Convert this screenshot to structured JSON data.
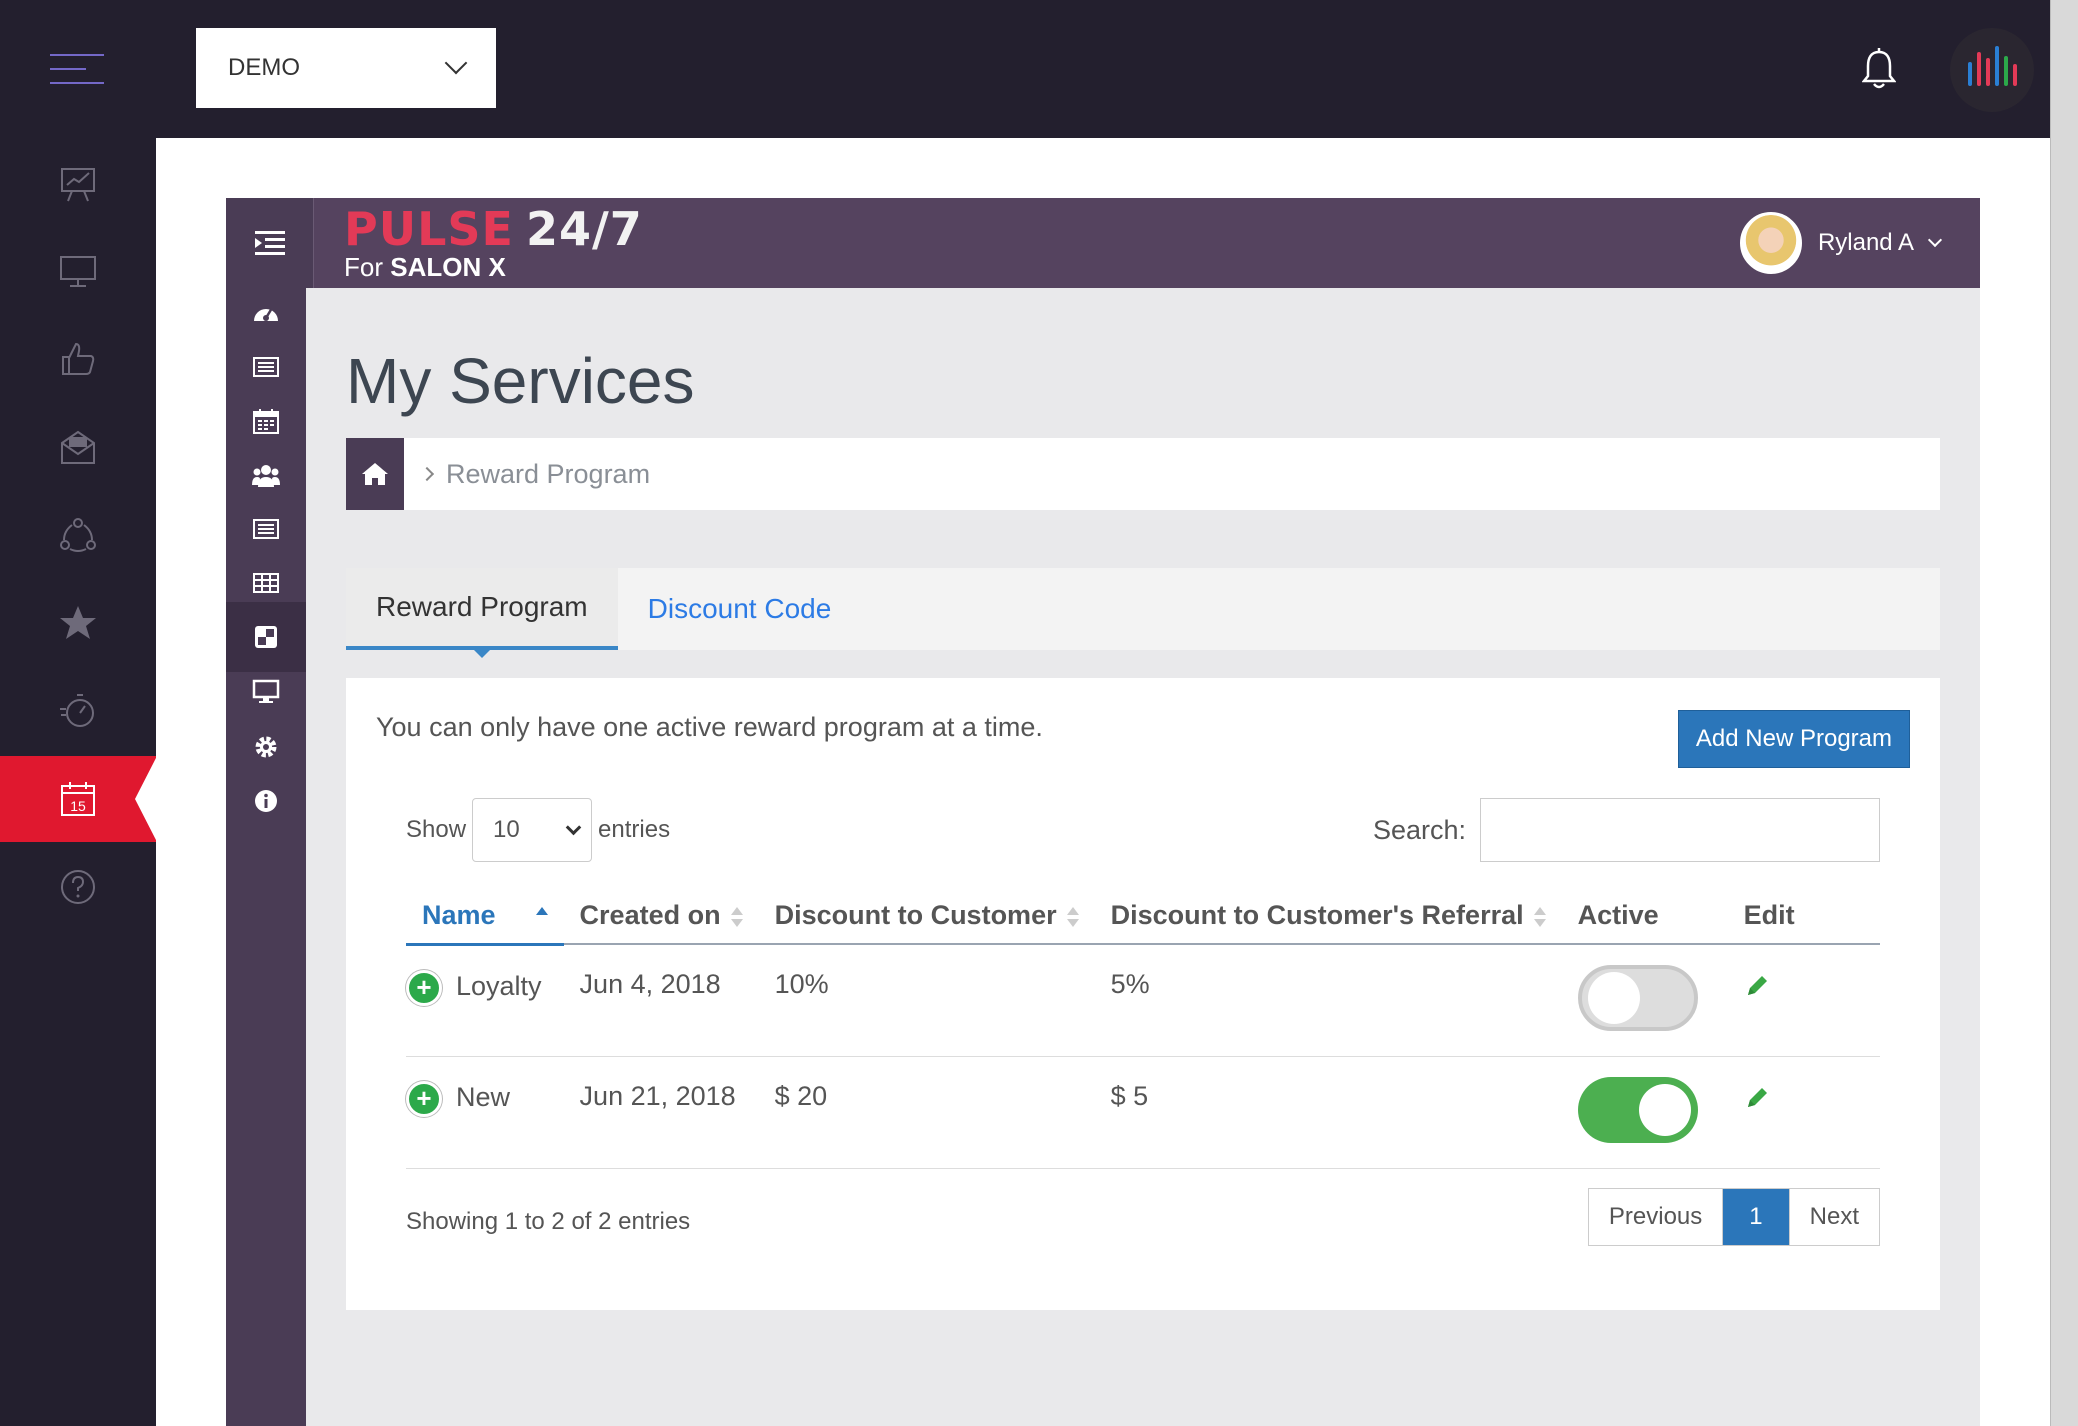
{
  "topbar": {
    "org_selector_value": "DEMO",
    "icons": [
      "hamburger-icon",
      "bell-icon",
      "app-logo-icon"
    ]
  },
  "left_rail": {
    "items": [
      {
        "icon": "analytics-board-icon"
      },
      {
        "icon": "monitor-icon"
      },
      {
        "icon": "thumbs-up-icon"
      },
      {
        "icon": "mail-open-icon"
      },
      {
        "icon": "share-network-icon"
      },
      {
        "icon": "star-icon"
      },
      {
        "icon": "stopwatch-icon"
      },
      {
        "icon": "calendar-icon",
        "label": "15",
        "active": true
      },
      {
        "icon": "help-circle-icon"
      }
    ],
    "accent_color": "#e0182f"
  },
  "pulse": {
    "brand_part1": "PULSE",
    "brand_part2": "24/7",
    "brand_for": "For",
    "brand_salon": "SALON X",
    "user_name": "Ryland A",
    "sidebar_icons": [
      "dashboard-gauge-icon",
      "list-icon",
      "calendar-icon",
      "users-icon",
      "list-alt-icon",
      "table-icon",
      "services-icon",
      "monitor-icon",
      "settings-gear-icon",
      "info-icon"
    ],
    "header_color": "#55435f"
  },
  "page": {
    "title": "My Services",
    "breadcrumb": "Reward Program",
    "tabs": [
      {
        "label": "Reward Program",
        "active": true
      },
      {
        "label": "Discount Code",
        "active": false
      }
    ],
    "notice": "You can only have one active reward program at a time.",
    "add_button": "Add New Program"
  },
  "table_controls": {
    "show_label": "Show",
    "entries_value": "10",
    "entries_label": "entries",
    "search_label": "Search:",
    "search_value": ""
  },
  "table": {
    "columns": [
      "Name",
      "Created on",
      "Discount to Customer",
      "Discount to Customer's Referral",
      "Active",
      "Edit"
    ],
    "rows": [
      {
        "name": "Loyalty",
        "created": "Jun 4, 2018",
        "discount": "10%",
        "referral": "5%",
        "active": false
      },
      {
        "name": "New",
        "created": "Jun 21, 2018",
        "discount": "$ 20",
        "referral": "$ 5",
        "active": true
      }
    ]
  },
  "footer": {
    "info": "Showing 1 to 2 of 2 entries",
    "previous": "Previous",
    "current_page": "1",
    "next": "Next"
  }
}
